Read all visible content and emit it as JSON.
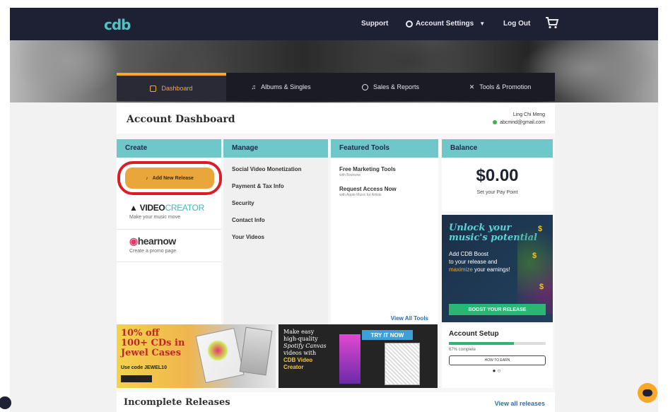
{
  "nav": {
    "logo": "cdb",
    "support": "Support",
    "account_settings": "Account Settings",
    "log_out": "Log Out"
  },
  "tabs": [
    {
      "label": "Dashboard"
    },
    {
      "label": "Albums & Singles"
    },
    {
      "label": "Sales & Reports"
    },
    {
      "label": "Tools & Promotion"
    }
  ],
  "account": {
    "title": "Account Dashboard",
    "user_name": "Ling Chi Meng",
    "user_email": "abcmnd@gmail.com"
  },
  "create": {
    "header": "Create",
    "add_release": "Add New Release",
    "video_creator_a": "VIDEO",
    "video_creator_b": "CREATOR",
    "video_creator_sub": "Make your music move",
    "hearnow": "hearnow",
    "hearnow_sub": "Create a promo page"
  },
  "manage": {
    "header": "Manage",
    "items": [
      "Social Video Monetization",
      "Payment & Tax Info",
      "Security",
      "Contact Info",
      "Your Videos"
    ]
  },
  "tools": {
    "header": "Featured Tools",
    "items": [
      {
        "title": "Free Marketing Tools",
        "sub": "with Bowwow"
      },
      {
        "title": "Request Access Now",
        "sub": "with Apple Music for Artists"
      }
    ],
    "view_all": "View All Tools"
  },
  "balance": {
    "header": "Balance",
    "amount": "$0.00",
    "sub": "Set your Pay Point",
    "promo_title_1": "Unlock your",
    "promo_title_2": "music's potential",
    "promo_text_1": "Add CDB Boost",
    "promo_text_2": "to your release and",
    "promo_text_hl": "maximize",
    "promo_text_3": "your earnings!",
    "promo_button": "BOOST YOUR RELEASE"
  },
  "banners": {
    "cd_line1": "10% off",
    "cd_line2": "100+ CDs in",
    "cd_line3": "Jewel Cases",
    "cd_code": "Use code JEWEL10",
    "spot_line1": "Make easy",
    "spot_line2": "high-quality",
    "spot_line3": "Spotify Canvas",
    "spot_line4": "videos with",
    "spot_line5": "CDB Video",
    "spot_line6": "Creator",
    "spot_try": "TRY IT NOW"
  },
  "setup": {
    "title": "Account Setup",
    "progress": 0.67,
    "pct": "67% complete",
    "button": "HOW TO EARN"
  },
  "incomplete": {
    "title": "Incomplete Releases",
    "link": "View all releases"
  },
  "colors": {
    "nav_bg": "#1e2033",
    "accent": "#f7a827",
    "teal": "#6fc7c9",
    "highlight_ring": "#d91f26",
    "green": "#2bb673"
  }
}
